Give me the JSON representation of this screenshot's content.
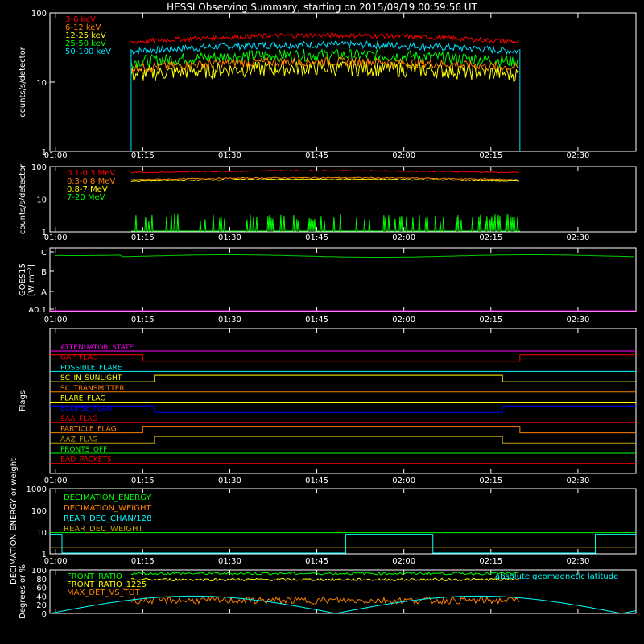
{
  "title": "HESSI Observing Summary, starting on 2015/09/19 00:59:56 UT",
  "time_ticks": [
    "01:00",
    "01:15",
    "01:30",
    "01:45",
    "02:00",
    "02:15",
    "02:30"
  ],
  "chart_data": [
    {
      "type": "line",
      "name": "counts-low",
      "ylabel": "counts/s/detector",
      "yscale": "log",
      "ylim": [
        1,
        100
      ],
      "y_ticks": [
        "1",
        "10",
        "100"
      ],
      "time_range": [
        "01:00",
        "02:40"
      ],
      "observing_window": [
        "01:13",
        "02:20"
      ],
      "series": [
        {
          "name": "3-6 keV",
          "color": "#ff0000",
          "level": 38,
          "noise": 0.08
        },
        {
          "name": "6-12 keV",
          "color": "#ff8000",
          "level": 16,
          "noise": 0.15
        },
        {
          "name": "12-25 keV",
          "color": "#ffff00",
          "level": 13,
          "noise": 0.25
        },
        {
          "name": "25-50 keV",
          "color": "#00ff00",
          "level": 20,
          "noise": 0.2
        },
        {
          "name": "50-100 keV",
          "color": "#00e0ff",
          "level": 28,
          "noise": 0.12
        }
      ]
    },
    {
      "type": "line",
      "name": "counts-high",
      "ylabel": "counts/s/detector",
      "yscale": "log",
      "ylim": [
        1,
        100
      ],
      "y_ticks": [
        "1",
        "10",
        "100"
      ],
      "series": [
        {
          "name": "0.1-0.3 MeV",
          "color": "#ff0000",
          "level": 65,
          "noise": 0.04
        },
        {
          "name": "0.3-0.8 MeV",
          "color": "#ff8000",
          "level": 40,
          "noise": 0.04
        },
        {
          "name": "0.8-7 MeV",
          "color": "#ffff00",
          "level": 36,
          "noise": 0.04
        },
        {
          "name": "7-20 MeV",
          "color": "#00ff00",
          "level": 1,
          "noise": 0
        }
      ]
    },
    {
      "type": "line",
      "name": "goes",
      "ylabel": "GOES15",
      "yunit": "[W m⁻²]",
      "y_ticks": [
        "A0.1",
        "A",
        "B",
        "C"
      ],
      "series": [
        {
          "name": "GOES15",
          "color": "#00cc00",
          "level": "C"
        }
      ]
    },
    {
      "type": "line",
      "name": "flags",
      "ylabel": "Flags",
      "series": [
        {
          "name": "ATTENUATOR_STATE",
          "color": "#ff00ff",
          "state": [
            [
              0,
              0
            ]
          ]
        },
        {
          "name": "GAP_FLAG",
          "color": "#ff0000",
          "state": [
            [
              "01:00",
              1
            ],
            [
              "01:15",
              0
            ],
            [
              "02:20",
              1
            ]
          ]
        },
        {
          "name": "POSSIBLE_FLARE",
          "color": "#00ffff",
          "state": [
            [
              0,
              0
            ]
          ]
        },
        {
          "name": "SC_IN_SUNLIGHT",
          "color": "#ffff00",
          "state": [
            [
              "01:00",
              0
            ],
            [
              "01:17",
              1
            ],
            [
              "02:17",
              0
            ]
          ]
        },
        {
          "name": "SC_TRANSMITTER",
          "color": "#ff8000",
          "state": [
            [
              0,
              0
            ]
          ]
        },
        {
          "name": "FLARE_FLAG",
          "color": "#ffff00",
          "state": [
            [
              0,
              0
            ]
          ]
        },
        {
          "name": "ECLIPSE_FLAG",
          "color": "#0000ff",
          "state": [
            [
              "01:00",
              1
            ],
            [
              "01:17",
              0
            ],
            [
              "02:17",
              1
            ]
          ]
        },
        {
          "name": "SAA_FLAG",
          "color": "#ff0000",
          "state": [
            [
              0,
              0
            ]
          ]
        },
        {
          "name": "PARTICLE_FLAG",
          "color": "#ff8000",
          "state": [
            [
              "01:00",
              0
            ],
            [
              "01:15",
              1
            ],
            [
              "02:20",
              0
            ]
          ]
        },
        {
          "name": "AAZ_FLAG",
          "color": "#c0a000",
          "state": [
            [
              "01:00",
              0
            ],
            [
              "01:17",
              1
            ],
            [
              "02:17",
              0
            ]
          ]
        },
        {
          "name": "FRONTS_OFF",
          "color": "#00ff00",
          "state": [
            [
              0,
              0
            ]
          ]
        },
        {
          "name": "BAD_PACKETS",
          "color": "#ff0000",
          "state": [
            [
              0,
              0
            ]
          ]
        }
      ]
    },
    {
      "type": "line",
      "name": "decimation",
      "ylabel": "DECIMATION ENERGY or weight",
      "yscale": "log",
      "ylim": [
        1,
        1000
      ],
      "y_ticks": [
        "1",
        "10",
        "100",
        "1000"
      ],
      "series": [
        {
          "name": "DECIMATION_ENERGY",
          "color": "#00ff00"
        },
        {
          "name": "DECIMATION_WEIGHT",
          "color": "#ff8000"
        },
        {
          "name": "REAR_DEC_CHAN/128",
          "color": "#00ffff"
        },
        {
          "name": "REAR_DEC_WEIGHT",
          "color": "#c0a000"
        }
      ]
    },
    {
      "type": "line",
      "name": "ratios",
      "ylabel": "Degrees or %",
      "ylim": [
        0,
        100
      ],
      "y_ticks": [
        "0",
        "20",
        "40",
        "60",
        "80",
        "100"
      ],
      "series": [
        {
          "name": "FRONT_RATIO",
          "color": "#00ff00"
        },
        {
          "name": "FRONT_RATIO_1225",
          "color": "#ffff00"
        },
        {
          "name": "MAX_DET_VS_TOT",
          "color": "#ff8000"
        },
        {
          "name": "absolute geomagnetic latitude",
          "color": "#00ffff"
        }
      ]
    }
  ]
}
